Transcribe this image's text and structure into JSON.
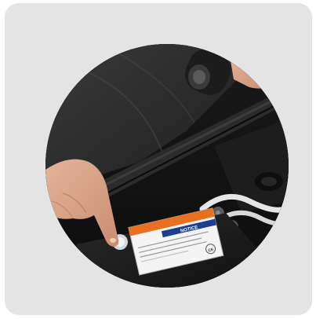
{
  "photo": {
    "subject": "hand-pressing-button-engine-bay",
    "shape": "circle",
    "frame_color": "#e4e4e4",
    "label_accent": "#e8701e",
    "label_header_blue": "#1e3f8f",
    "label_text_header": "NOTICE",
    "label_mark": "CE"
  }
}
